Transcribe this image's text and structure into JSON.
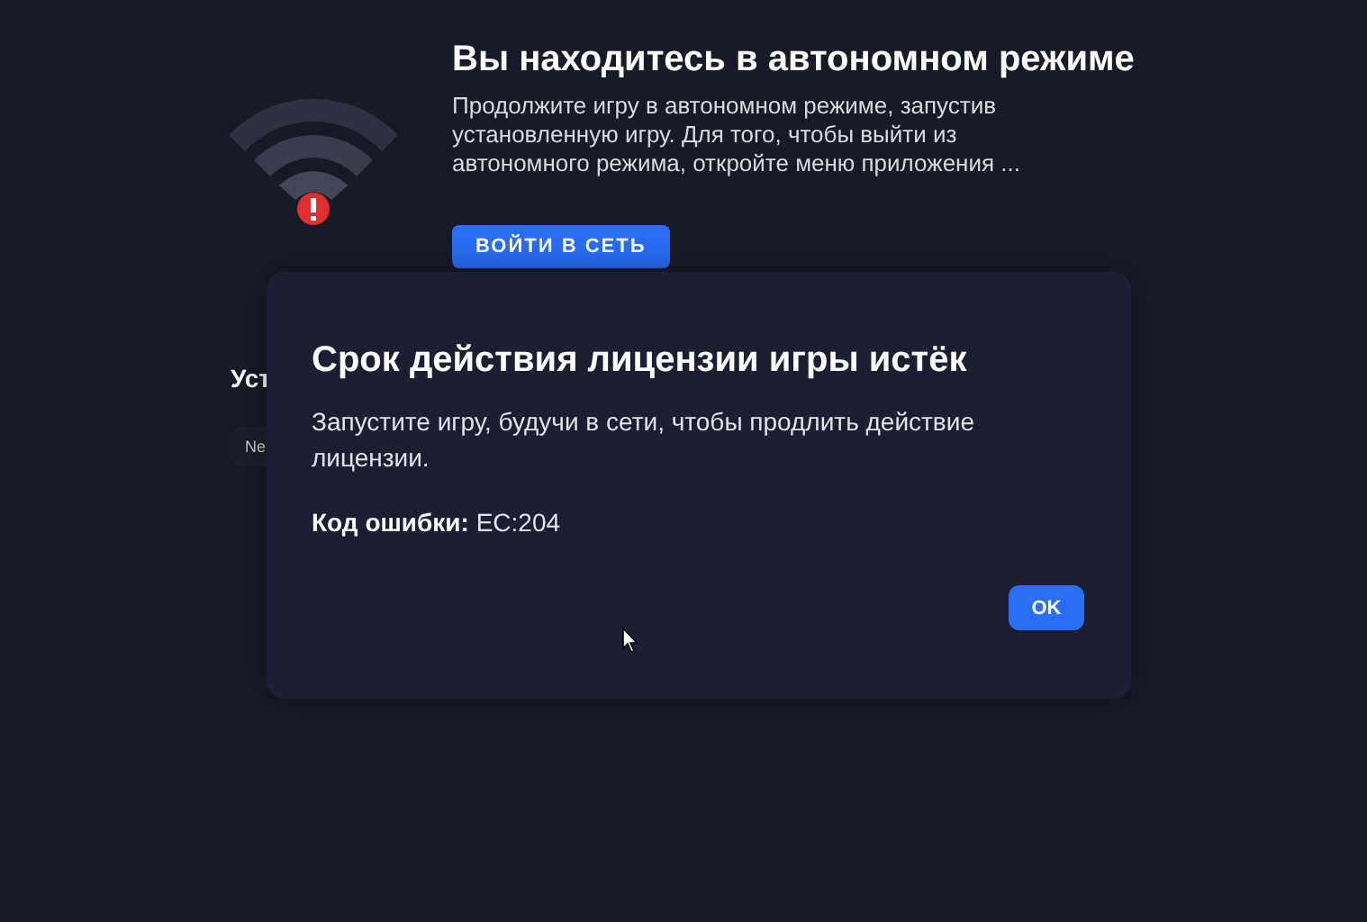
{
  "offline_banner": {
    "title": "Вы находитесь в автономном режиме",
    "description": "Продолжите игру в автономном режиме, запустив установленную игру. Для того, чтобы выйти из автономного режима, откройте меню приложения ...",
    "button": "ВОЙТИ В СЕТЬ"
  },
  "section": {
    "heading": "Уст",
    "chip": "Ne"
  },
  "dialog": {
    "title": "Срок действия лицензии игры истёк",
    "message": "Запустите игру, будучи в сети, чтобы продлить действие лицензии.",
    "error_code": "**Код ошибки:** EC:204",
    "button": "OK"
  }
}
